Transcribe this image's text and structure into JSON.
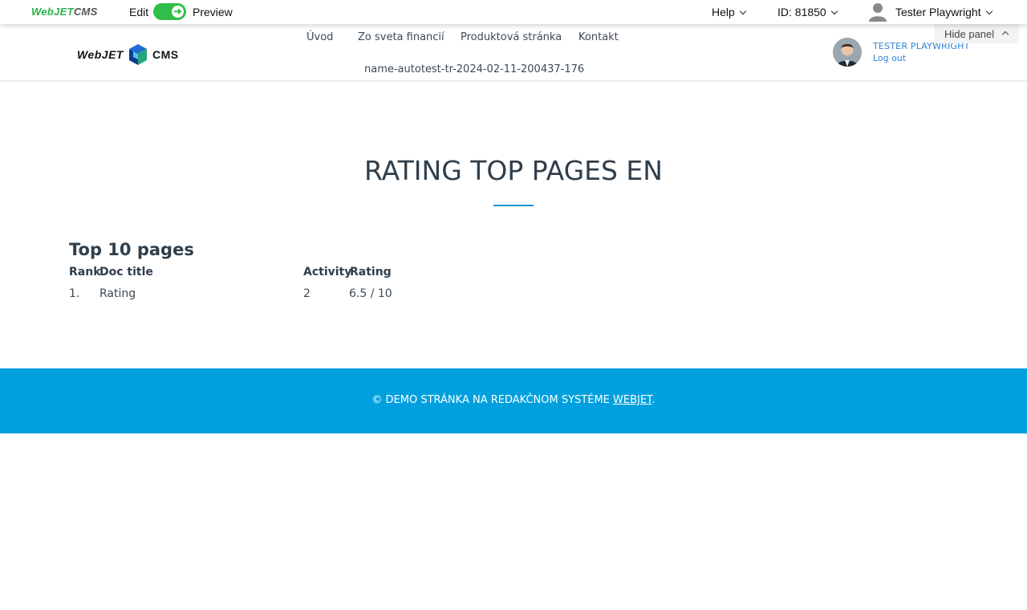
{
  "admin_bar": {
    "logo": {
      "part1": "Web",
      "part2": "JET",
      "part3": "CMS"
    },
    "edit_label": "Edit",
    "preview_label": "Preview",
    "help_label": "Help",
    "doc_id_label": "ID: 81850",
    "user_label": "Tester Playwright",
    "accent_color": "#2fbf48"
  },
  "site_header": {
    "logo": {
      "part1": "WebJET",
      "part2": "CMS"
    },
    "nav": [
      "Úvod",
      "Zo sveta financií",
      "Produktová stránka",
      "Kontakt",
      "name-autotest-tr-2024-02-11-200437-176"
    ],
    "user_name": "TESTER PLAYWRIGHT",
    "logout_label": "Log out",
    "hide_panel_label": "Hide panel"
  },
  "main": {
    "page_title": "RATING TOP PAGES EN",
    "section_heading": "Top 10 pages",
    "table": {
      "headers": {
        "rank": "Rank",
        "title": "Doc title",
        "activity": "Activity",
        "rating": "Rating"
      },
      "rows": [
        {
          "rank": "1.",
          "title": "Rating",
          "activity": "2",
          "rating": "6.5 / 10"
        }
      ]
    },
    "accent_color": "#1b94d6"
  },
  "footer": {
    "text": "© DEMO STRÁNKA NA REDAKČNOM SYSTÉME ",
    "link_label": "WEBJET",
    "suffix": ".",
    "background_color": "#00a0df"
  }
}
